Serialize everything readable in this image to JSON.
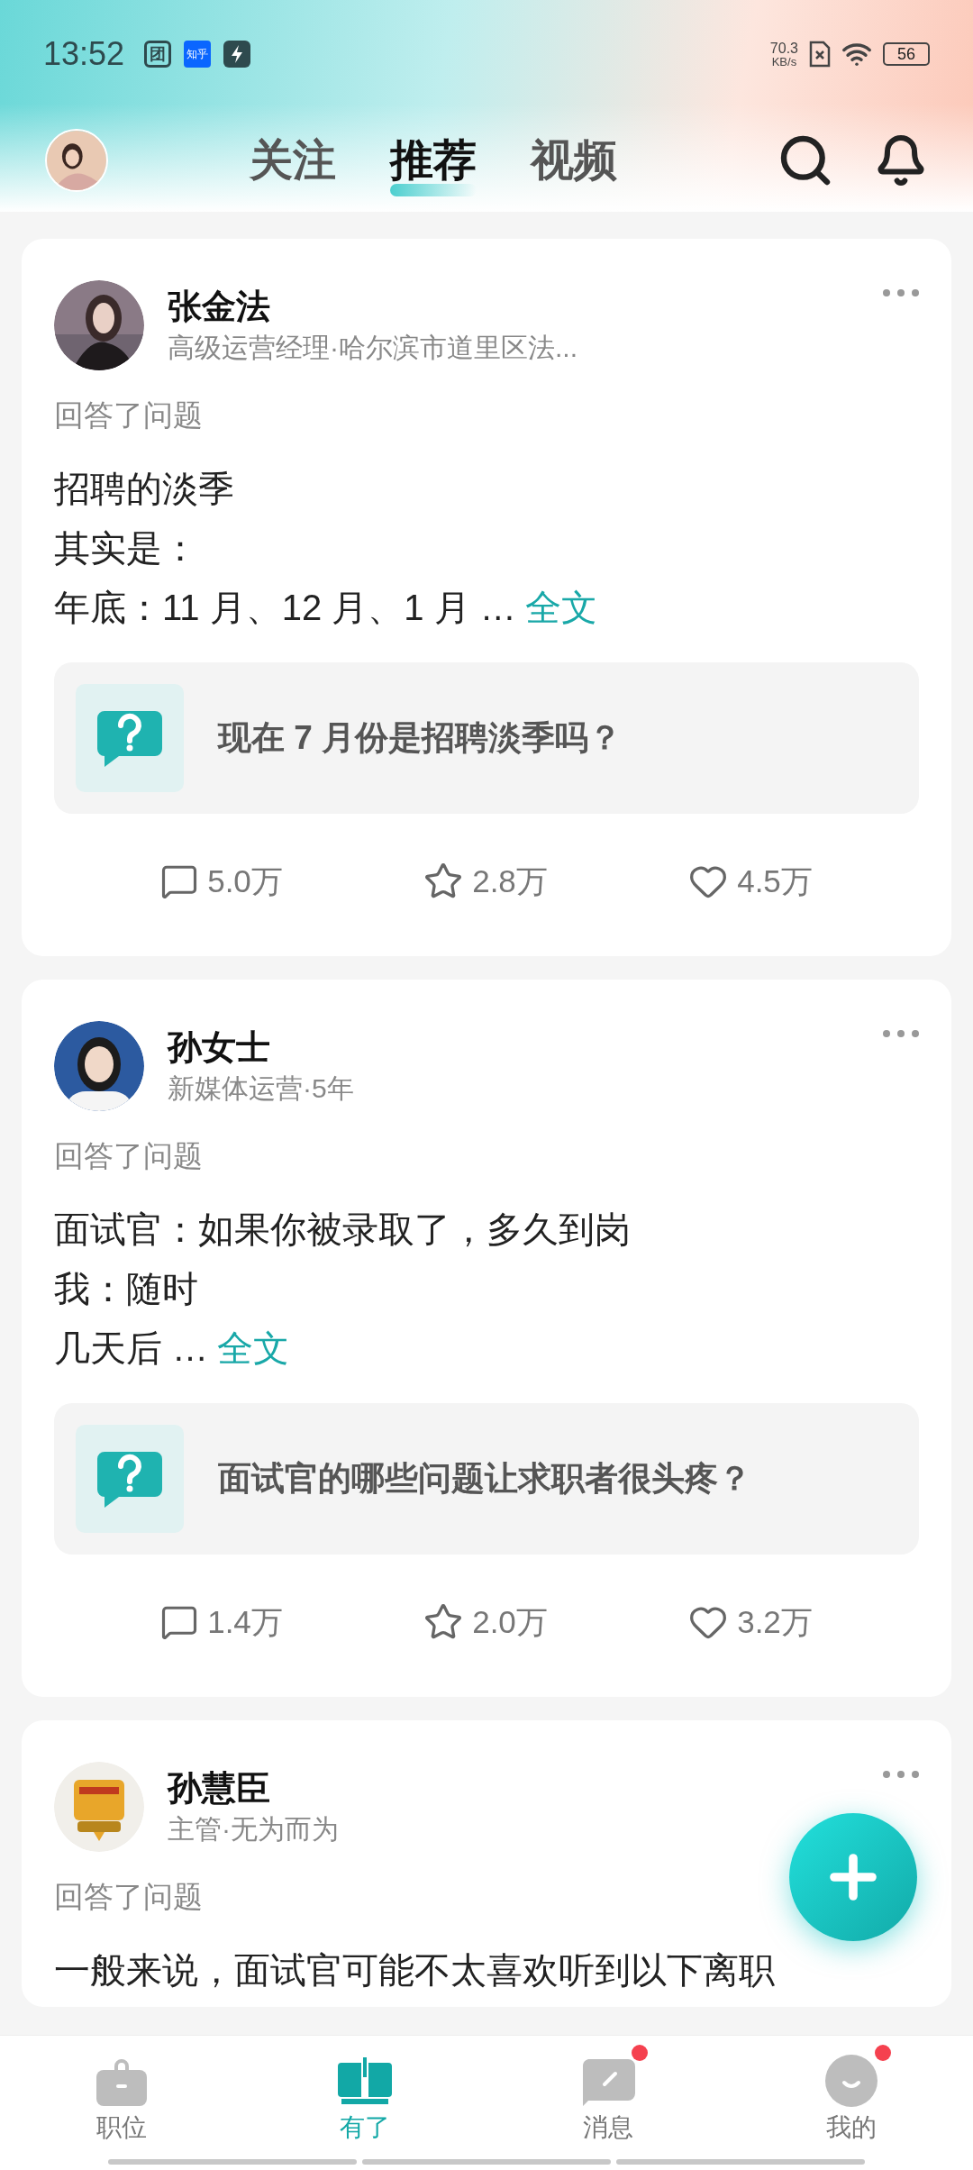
{
  "status_bar": {
    "time": "13:52",
    "apps": [
      {
        "kind": "tuan",
        "label": "团"
      },
      {
        "kind": "zhihu",
        "label": "知乎"
      },
      {
        "kind": "bolt"
      }
    ],
    "speed": "70.3",
    "speed_unit": "KB/s",
    "battery": "56"
  },
  "header": {
    "tabs": [
      {
        "label": "关注",
        "selected": false
      },
      {
        "label": "推荐",
        "selected": true
      },
      {
        "label": "视频",
        "selected": false
      }
    ]
  },
  "feed": [
    {
      "author": "张金法",
      "subtitle": "高级运营经理·哈尔滨市道里区法...",
      "action": "回答了问题",
      "lines": [
        "招聘的淡季",
        "其实是：",
        "年底：11 月、12 月、1 月 …"
      ],
      "more": "全文",
      "question": "现在 7 月份是招聘淡季吗？",
      "comments": "5.0万",
      "stars": "2.8万",
      "likes": "4.5万"
    },
    {
      "author": "孙女士",
      "subtitle": "新媒体运营·5年",
      "action": "回答了问题",
      "lines": [
        "面试官：如果你被录取了，多久到岗",
        "我：随时",
        "几天后 …"
      ],
      "more": "全文",
      "question": "面试官的哪些问题让求职者很头疼？",
      "comments": "1.4万",
      "stars": "2.0万",
      "likes": "3.2万"
    },
    {
      "author": "孙慧臣",
      "subtitle": "主管·无为而为",
      "action": "回答了问题",
      "lines": [
        "一般来说，面试官可能不太喜欢听到以下离职"
      ]
    }
  ],
  "bottom_nav": [
    {
      "label": "职位",
      "selected": false,
      "badge": false,
      "kind": "bag"
    },
    {
      "label": "有了",
      "selected": true,
      "badge": false,
      "kind": "book"
    },
    {
      "label": "消息",
      "selected": false,
      "badge": true,
      "kind": "chat"
    },
    {
      "label": "我的",
      "selected": false,
      "badge": true,
      "kind": "face"
    }
  ]
}
